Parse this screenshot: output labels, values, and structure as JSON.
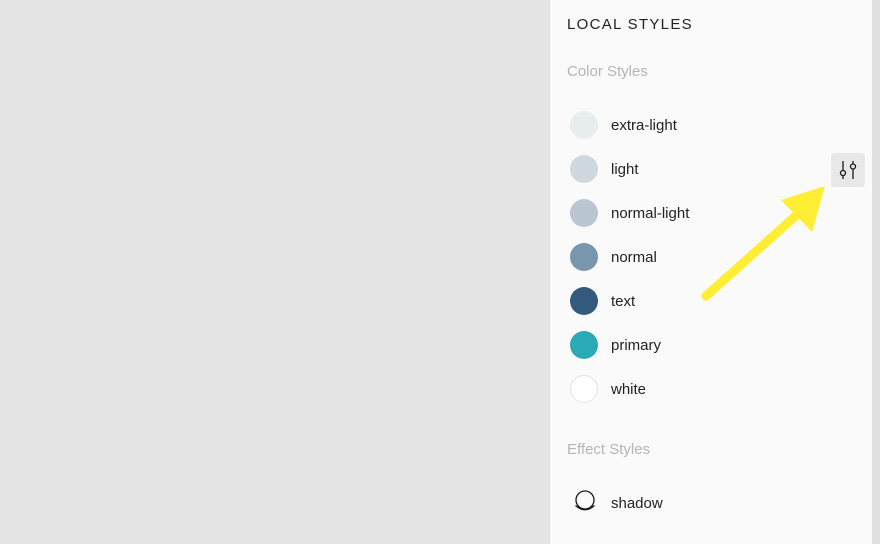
{
  "panel": {
    "title": "LOCAL STYLES"
  },
  "color_styles": {
    "heading": "Color Styles",
    "items": [
      {
        "label": "extra-light",
        "color": "#e8edf0"
      },
      {
        "label": "light",
        "color": "#cfd8df"
      },
      {
        "label": "normal-light",
        "color": "#bac7d2"
      },
      {
        "label": "normal",
        "color": "#7896ad"
      },
      {
        "label": "text",
        "color": "#33597c"
      },
      {
        "label": "primary",
        "color": "#2baab5"
      },
      {
        "label": "white",
        "color": "#ffffff"
      }
    ]
  },
  "effect_styles": {
    "heading": "Effect Styles",
    "items": [
      {
        "label": "shadow",
        "icon": "shadow-effect-icon"
      }
    ]
  },
  "adjust_button": {
    "icon": "sliders-icon"
  },
  "annotation": {
    "arrow_color": "#ffee33"
  }
}
